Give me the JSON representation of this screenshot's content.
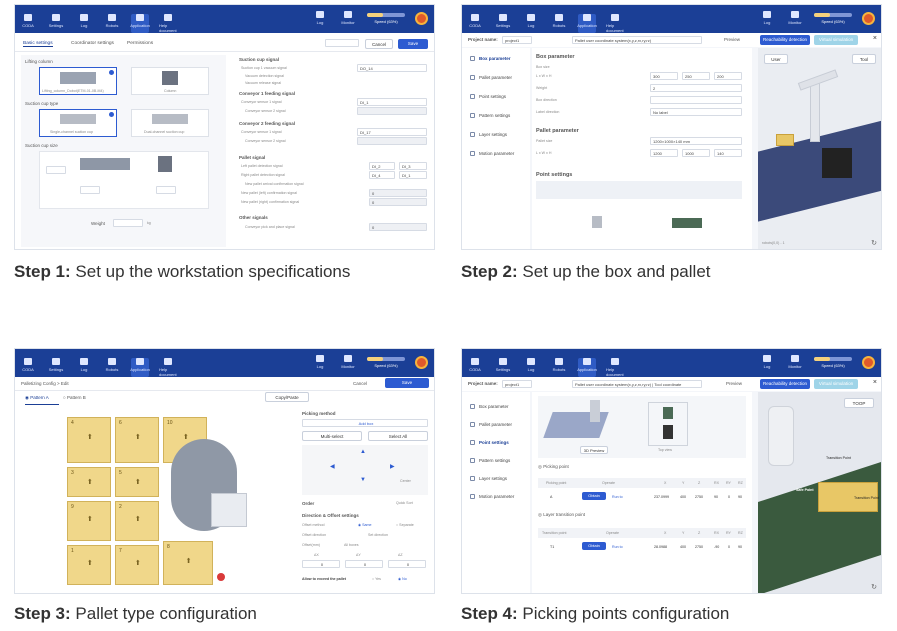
{
  "steps": [
    {
      "bold": "Step 1:",
      "text": " Set up the workstation specifications"
    },
    {
      "bold": "Step 2:",
      "text": " Set up the box and pallet"
    },
    {
      "bold": "Step 3:",
      "text": " Pallet type configuration"
    },
    {
      "bold": "Step 4:",
      "text": " Picking points configuration"
    }
  ],
  "app": {
    "toolbar": [
      "CODA",
      "Settings",
      "Log",
      "Robots",
      "Application",
      "Help document"
    ],
    "right": [
      "Log",
      "Monitor",
      "Speed (63%)"
    ]
  },
  "s1": {
    "tabs": [
      "Basic settings",
      "Coordinator settings",
      "Permissions"
    ],
    "buttons": [
      "Cancel",
      "Save"
    ],
    "lifting_column": "Lifting column",
    "col_opts": [
      "Lifting_column_Dobot(ETM-01-0B-M4)",
      "Column"
    ],
    "suction_type": "Suction cup type",
    "suction_opts": [
      "Single-channel suction cup",
      "Dual-channel suction cup"
    ],
    "suction_size": "Suction cup size",
    "weight": "Weight",
    "weight_unit": "kg",
    "right_head": "Suction cup signal",
    "sig_rows": [
      "Suction cup 1 vacuum signal",
      "Vacuum detection signal",
      "Vacuum release signal"
    ],
    "conv1": "Conveyor 1 feeding signal",
    "conv1_rows": [
      "Conveyor sensor 1 signal",
      "Conveyor sensor 2 signal"
    ],
    "conv2": "Conveyor 2 feeding signal",
    "conv2_rows": [
      "Conveyor sensor 1 signal",
      "Conveyor sensor 2 signal"
    ],
    "pallet": "Pallet signal",
    "pallet_rows": [
      "Left pallet detection signal",
      "Right pallet detection signal",
      "New pallet arrival confirmation signal",
      "New pallet (left) confirmation signal",
      "New pallet (right) confirmation signal"
    ],
    "other": "Other signals",
    "other_rows": [
      "Conveyor pick and place signal"
    ],
    "sel_vals": [
      "DO_14",
      "DI_1",
      "DI_17",
      "DI_2",
      "DI_3",
      "DI_4",
      "DI_1"
    ],
    "num_vals": [
      "0",
      "0",
      "0"
    ]
  },
  "s2": {
    "project_label": "Project name:",
    "project_val": "project1",
    "coord_text": "Pallet user coordinate system(x,y,z,rx,ry,rz)",
    "preview": "Preview",
    "reach": "Reachability detection",
    "virtual": "Virtual simulation",
    "nav": [
      "Box parameter",
      "Pallet parameter",
      "Point settings",
      "Pattern settings",
      "Layer settings",
      "Motion parameter"
    ],
    "box_param": "Box parameter",
    "box_size": "Box size",
    "lwh": "L x W x H",
    "weight": "Weight",
    "box_dir": "Box direction",
    "label_dir": "Label direction",
    "box_vals": [
      "300",
      "250",
      "200",
      "2",
      "No label"
    ],
    "pallet_param": "Pallet parameter",
    "pallet_size": "Pallet size",
    "pallet_sel": "1200×1000×140 mm",
    "pallet_vals": [
      "1200",
      "1000",
      "140"
    ],
    "point_settings": "Point settings",
    "view_btns": [
      "User",
      "Tool"
    ],
    "coord_readout": "robots(0,0) - 1"
  },
  "s3": {
    "title": "Palletizing Config > Edit",
    "buttons": [
      "Cancel",
      "Save"
    ],
    "patterns": [
      "Pattern A",
      "Pattern B"
    ],
    "copy": "Copy/Paste",
    "picking_method": "Picking method",
    "add_box": "Add box",
    "multi": "Multi-select",
    "select_all": "Select All",
    "center": "Center",
    "order": "Order",
    "quick": "Quick Sort",
    "dir_title": "Direction & Offset settings",
    "offset_method": "Offset method",
    "same": "Same",
    "separate": "Separate",
    "offset_dir": "Offset direction",
    "set_dir": "Set direction",
    "offset_all": "Offset(mm)",
    "all_boxes": "All boxes",
    "delta": [
      "ΔX",
      "ΔY",
      "ΔZ"
    ],
    "delta_vals": [
      "0",
      "0",
      "0"
    ],
    "allow": "Allow to exceed the pallet",
    "yes": "Yes",
    "no": "No",
    "box_nums": [
      "4",
      "6",
      "10",
      "3",
      "5",
      "9",
      "2",
      "8",
      "1",
      "7"
    ]
  },
  "s4": {
    "project_label": "Project name:",
    "project_val": "project1",
    "coord_text": "Pallet user coordinate system(x,y,z,rx,ry,rz) | Tool coordinate",
    "preview": "Preview",
    "reach": "Reachability detection",
    "virtual": "Virtual simulation",
    "nav": [
      "Box parameter",
      "Pallet parameter",
      "Point settings",
      "Pattern settings",
      "Layer settings",
      "Motion parameter"
    ],
    "view_btn": "3D Preview",
    "top_view": "Top view",
    "picking_point": "Picking point",
    "pick_cols": [
      "Picking point",
      "Operate",
      "X",
      "Y",
      "Z",
      "RX",
      "RY",
      "RZ"
    ],
    "pick_row": [
      "A",
      "Obtain",
      "Run to",
      "237.0999",
      "400",
      "2750",
      "90",
      "0",
      "90"
    ],
    "layer_point": "Layer transition point",
    "layer_cols": [
      "Transition point",
      "Operate",
      "X",
      "Y",
      "Z",
      "RX",
      "RY",
      "RZ"
    ],
    "layer_row": [
      "T1",
      "Obtain",
      "Run to",
      "28.0988",
      "400",
      "2750",
      "-90",
      "0",
      "90"
    ],
    "scene_labels": [
      "Safe Point",
      "Transition Point",
      "Transition Point"
    ],
    "tool": "TOOP"
  }
}
